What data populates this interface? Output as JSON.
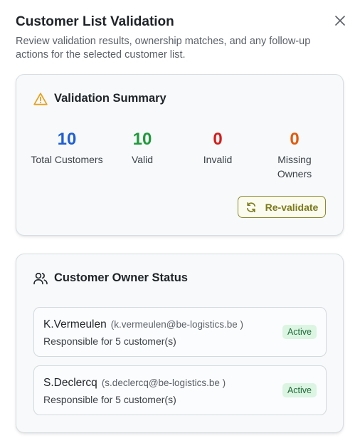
{
  "dialog": {
    "title": "Customer List Validation",
    "subtitle": "Review validation results, ownership matches, and any follow-up actions for the selected customer list."
  },
  "summary": {
    "title": "Validation Summary",
    "icon": "warning-triangle-icon",
    "stats": [
      {
        "value": "10",
        "label": "Total Customers",
        "color": "#1f5fd6"
      },
      {
        "value": "10",
        "label": "Valid",
        "color": "#1f9a3c"
      },
      {
        "value": "0",
        "label": "Invalid",
        "color": "#d41c1c"
      },
      {
        "value": "0",
        "label": "Missing Owners",
        "color": "#e45a0c"
      }
    ],
    "revalidate_label": "Re-validate"
  },
  "owners": {
    "title": "Customer Owner Status",
    "icon": "users-icon",
    "items": [
      {
        "name": "K.Vermeulen",
        "email": "(k.vermeulen@be-logistics.be )",
        "responsibility": "Responsible for 5 customer(s)",
        "status": "Active"
      },
      {
        "name": "S.Declercq",
        "email": "(s.declercq@be-logistics.be )",
        "responsibility": "Responsible for 5 customer(s)",
        "status": "Active"
      }
    ]
  }
}
